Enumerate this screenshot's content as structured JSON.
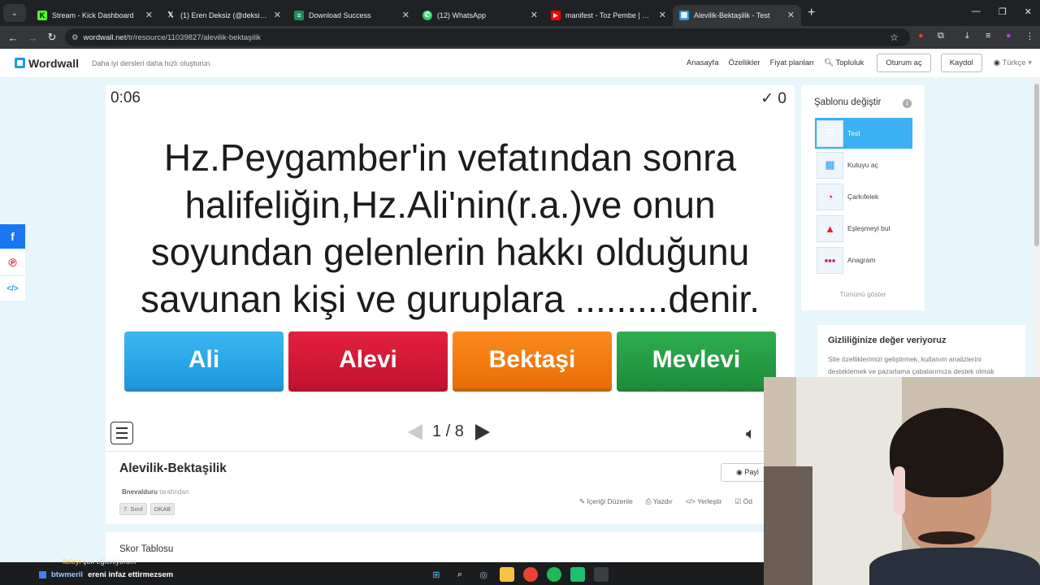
{
  "browser": {
    "tabs": [
      {
        "title": "Stream - Kick Dashboard",
        "icon": "kick-icon",
        "icon_color": "#53fc18",
        "active": false
      },
      {
        "title": "(1) Eren Deksiz (@deksizadam) ·",
        "icon": "x-icon",
        "icon_color": "#ffffff",
        "active": false
      },
      {
        "title": "Download Success",
        "icon": "download-page-icon",
        "icon_color": "#1f8a5a",
        "active": false
      },
      {
        "title": "(12) WhatsApp",
        "icon": "whatsapp-icon",
        "icon_color": "#25d366",
        "active": false
      },
      {
        "title": "manifest - Toz Pembe | Official M",
        "icon": "youtube-icon",
        "icon_color": "#ff0000",
        "active": false
      },
      {
        "title": "Alevilik-Bektaşilik - Test",
        "icon": "wordwall-icon",
        "icon_color": "#2199e8",
        "active": true
      }
    ],
    "url_host": "wordwall.net",
    "url_path": "/tr/resource/11039827/alevilik-bektaşilik"
  },
  "header": {
    "logo": "Wordwall",
    "tagline": "Daha iyi dersleri daha hızlı oluşturun",
    "nav": [
      "Anasayfa",
      "Özellikler",
      "Fiyat planları"
    ],
    "community": "Topluluk",
    "login": "Oturum aç",
    "signup": "Kaydol",
    "language": "Türkçe"
  },
  "game": {
    "timer": "0:06",
    "score_icon": "✓",
    "score": "0",
    "question": "Hz.Peygamber'in vefatından sonra halifeliğin,Hz.Ali'nin(r.a.)ve onun soyundan gelenlerin hakkı olduğunu savunan kişi ve guruplara .........denir.",
    "answers": [
      "Ali",
      "Alevi",
      "Bektaşi",
      "Mevlevi"
    ],
    "page_current": "1",
    "page_total": "8"
  },
  "activity": {
    "title": "Alevilik-Bektaşilik",
    "author": "Bnevalduru",
    "author_suffix": "tarafından",
    "tags": [
      "7. Sınıf",
      "DKAB"
    ],
    "actions": [
      "İçeriği Düzenle",
      "Yazdır",
      "Yerleştir",
      "Öd"
    ],
    "share_label": "Payl",
    "leaderboard_title": "Skor Tablosu"
  },
  "sidebar": {
    "title": "Şablonu değiştir",
    "templates": [
      "Test",
      "Kutuyu aç",
      "Çarkıfelek",
      "Eşleşmeyi bul",
      "Anagram"
    ],
    "show_all": "Tümünü göster"
  },
  "privacy": {
    "title": "Gizliliğinize değer veriyoruz",
    "text": "Site özelliklerimizi geliştirmek, kullanım analizlerini desteklemek ve pazarlama çabalarımıza destek olmak"
  },
  "chat": [
    {
      "user": "lleleyi",
      "message": "çok eğleniyorum"
    },
    {
      "user": "btwmeril",
      "message": "ereni infaz ettirmezsem"
    }
  ]
}
